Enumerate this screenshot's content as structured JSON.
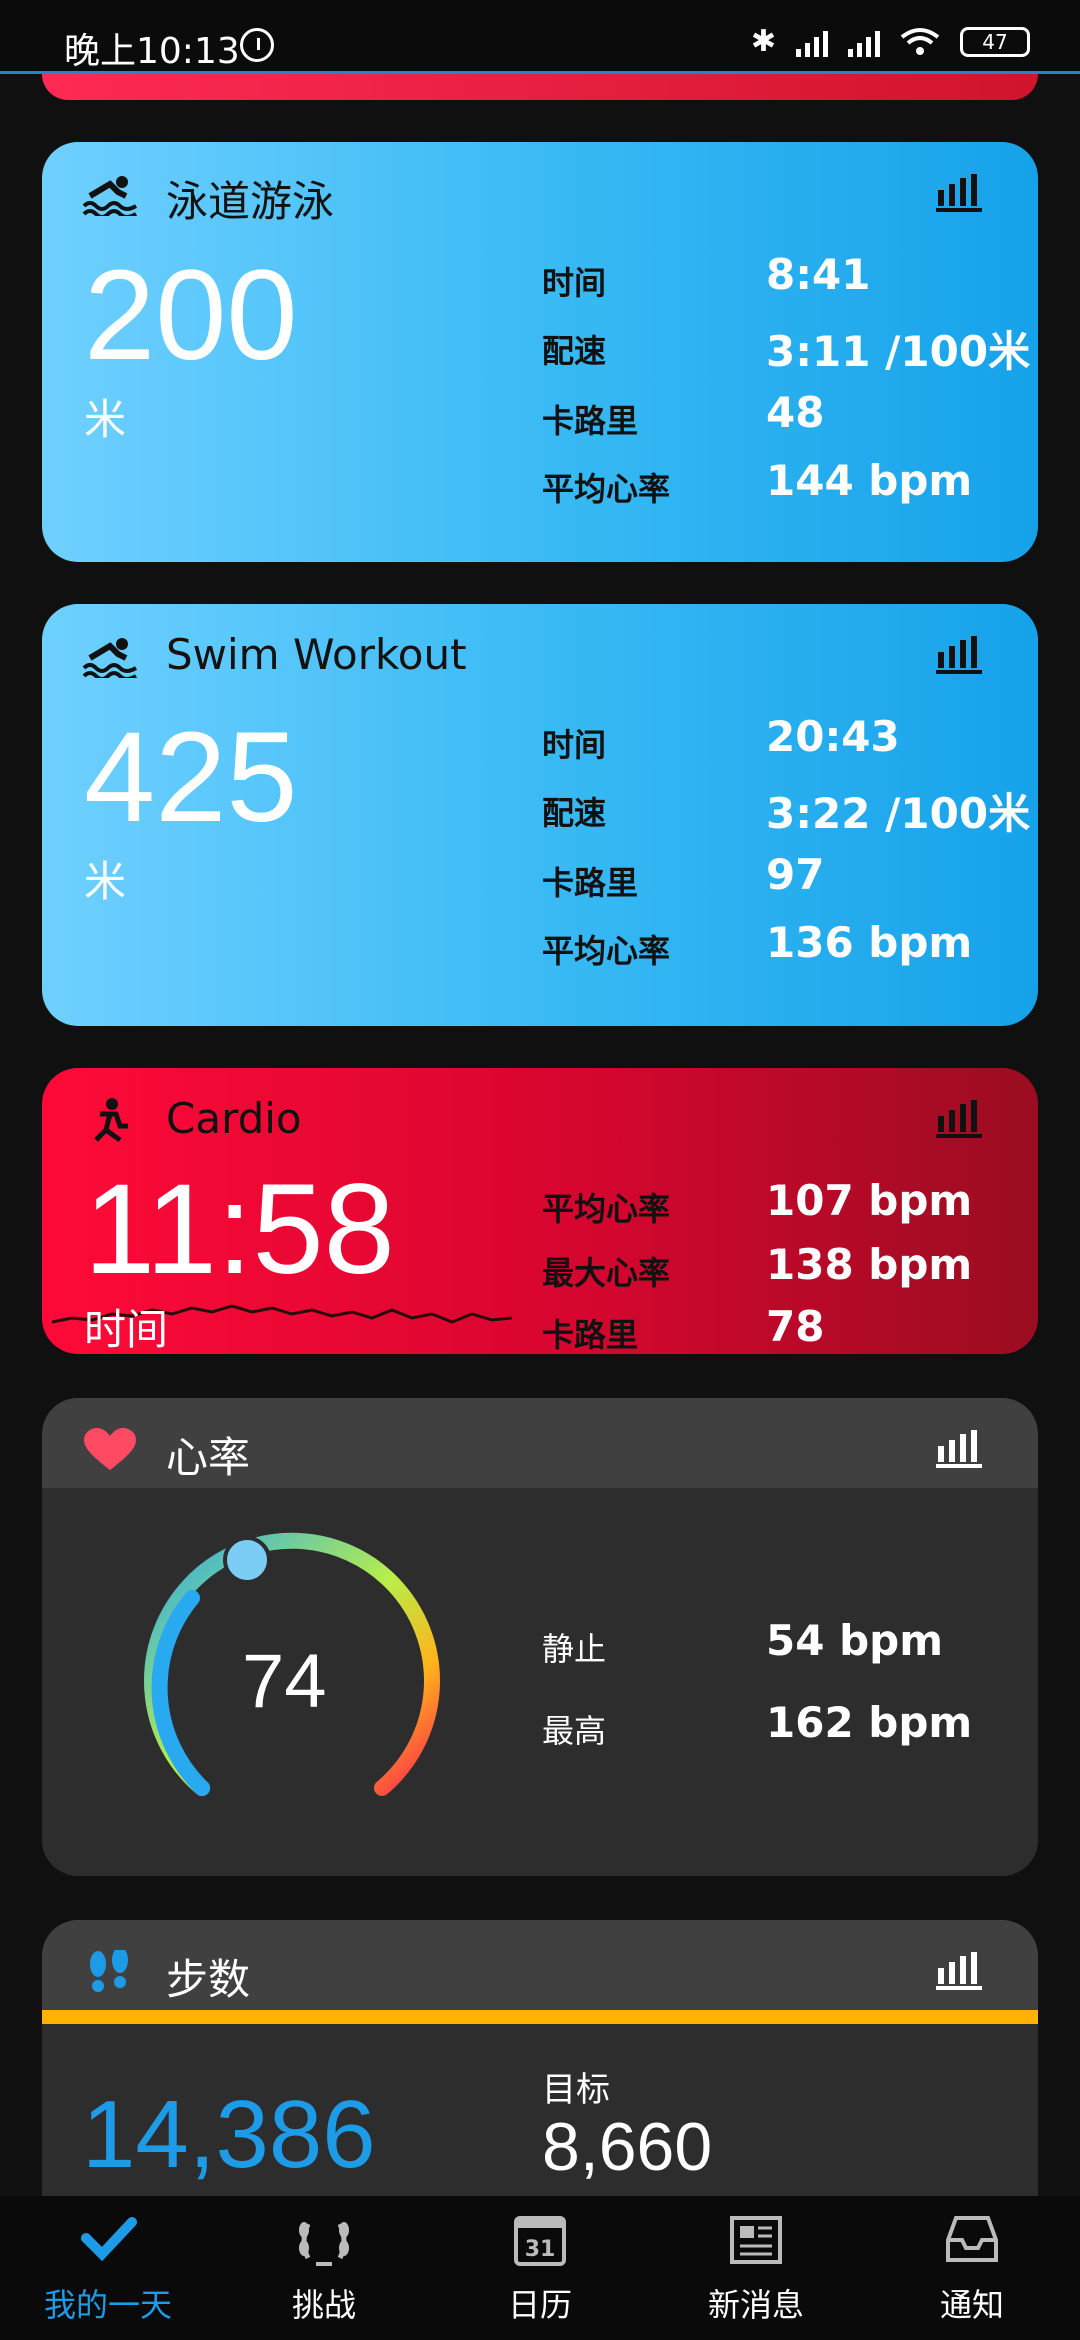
{
  "status_bar": {
    "time": "晚上10:13",
    "battery": "47"
  },
  "cards": {
    "lap_swim": {
      "title": "泳道游泳",
      "distance": "200",
      "unit": "米",
      "labels": [
        "时间",
        "配速",
        "卡路里",
        "平均心率"
      ],
      "values": [
        "8:41",
        "3:11 /100米",
        "48",
        "144 bpm"
      ]
    },
    "swim_workout": {
      "title": "Swim Workout",
      "distance": "425",
      "unit": "米",
      "labels": [
        "时间",
        "配速",
        "卡路里",
        "平均心率"
      ],
      "values": [
        "20:43",
        "3:22 /100米",
        "97",
        "136 bpm"
      ]
    },
    "cardio": {
      "title": "Cardio",
      "duration": "11:58",
      "unit": "时间",
      "labels": [
        "平均心率",
        "最大心率",
        "卡路里"
      ],
      "values": [
        "107 bpm",
        "138 bpm",
        "78"
      ]
    },
    "heart_rate": {
      "title": "心率",
      "current": "74",
      "labels": [
        "静止",
        "最高"
      ],
      "values": [
        "54 bpm",
        "162 bpm"
      ]
    },
    "steps": {
      "title": "步数",
      "count": "14,386",
      "goal_label": "目标",
      "goal_value": "8,660"
    }
  },
  "nav": {
    "items": [
      {
        "label": "我的一天",
        "icon": "check-icon",
        "active": true
      },
      {
        "label": "挑战",
        "icon": "laurel-icon",
        "active": false
      },
      {
        "label": "日历",
        "icon": "calendar-icon",
        "active": false,
        "day": "31"
      },
      {
        "label": "新消息",
        "icon": "newspaper-icon",
        "active": false
      },
      {
        "label": "通知",
        "icon": "inbox-icon",
        "active": false
      }
    ]
  },
  "colors": {
    "swim_blue": "#36b8f3",
    "cardio_red": "#d5062f",
    "accent_blue": "#1e9be6",
    "steps_bar": "#ffb300"
  }
}
